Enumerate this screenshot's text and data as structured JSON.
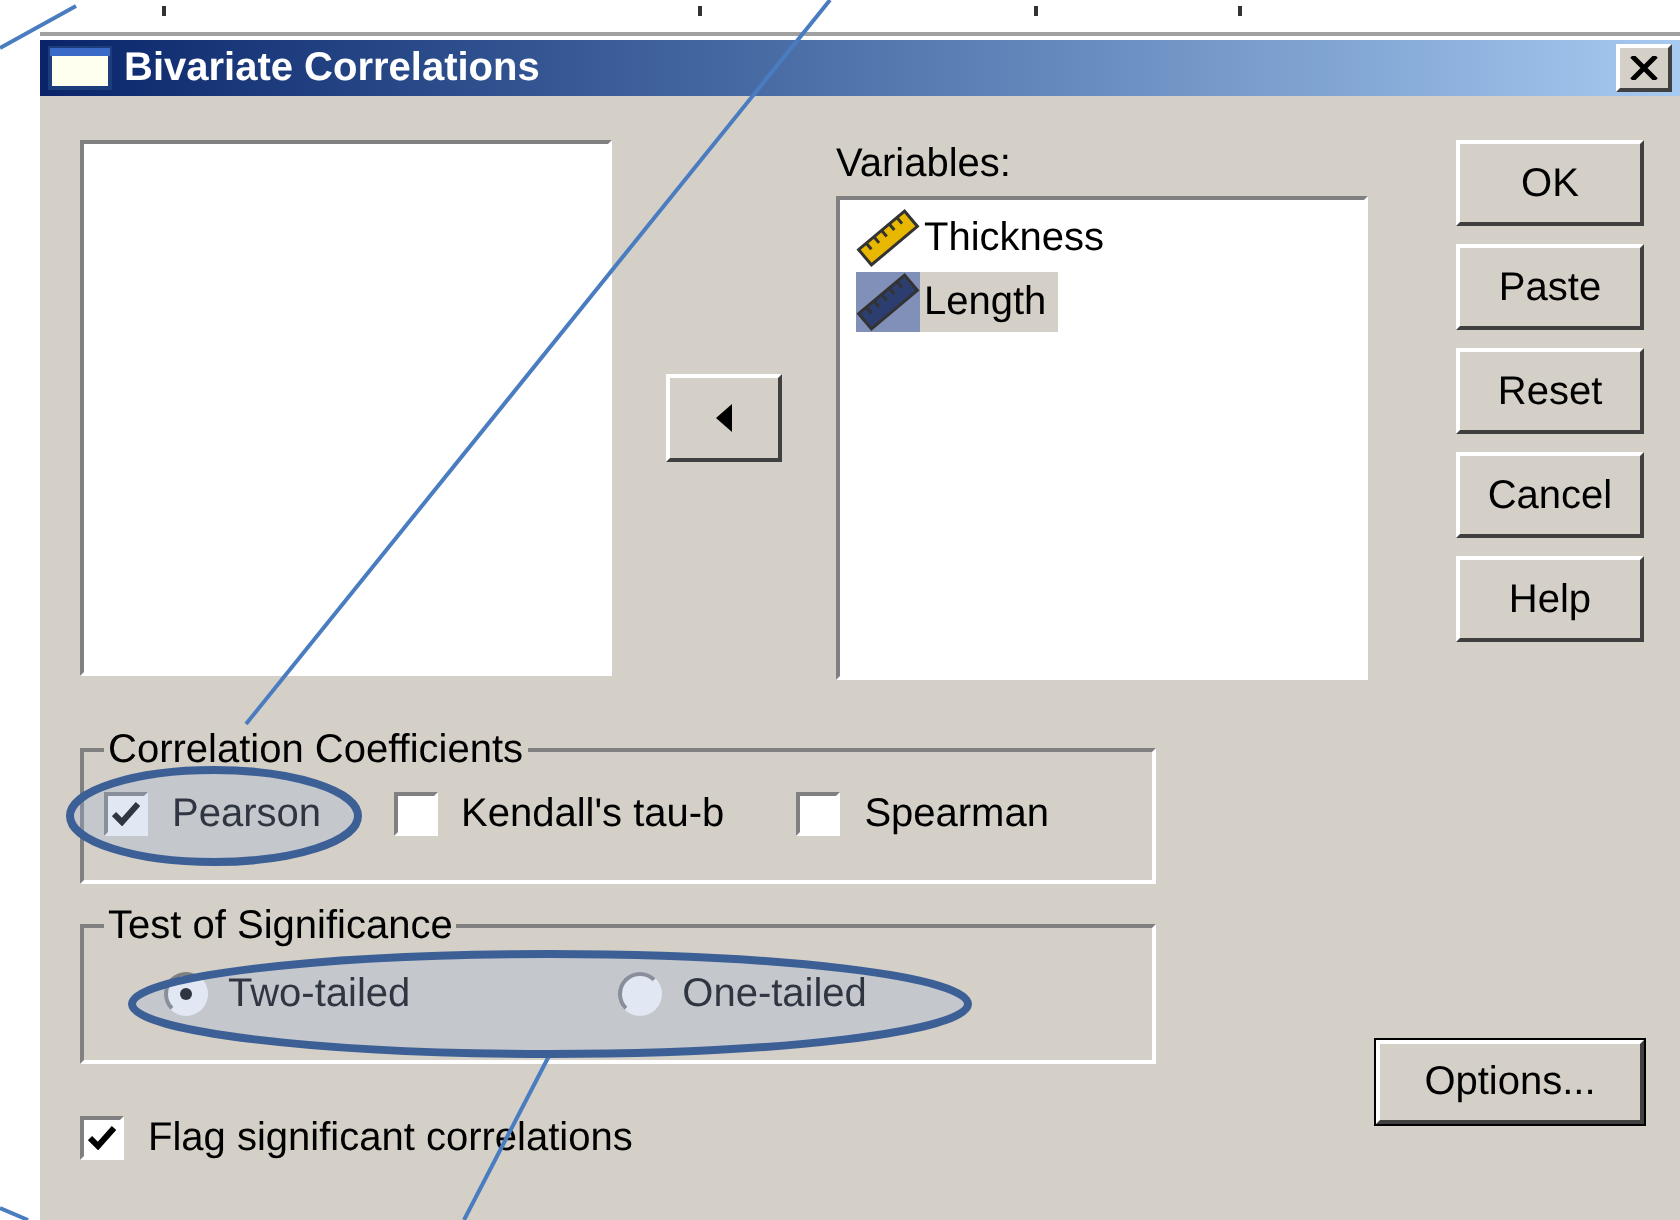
{
  "window": {
    "title": "Bivariate Correlations"
  },
  "variables": {
    "label": "Variables:",
    "items": [
      {
        "name": "Thickness",
        "selected": false
      },
      {
        "name": "Length",
        "selected": true
      }
    ]
  },
  "buttons": [
    "OK",
    "Paste",
    "Reset",
    "Cancel",
    "Help"
  ],
  "coefficients": {
    "title": "Correlation Coefficients",
    "items": [
      {
        "label": "Pearson",
        "checked": true
      },
      {
        "label": "Kendall's tau-b",
        "checked": false
      },
      {
        "label": "Spearman",
        "checked": false
      }
    ]
  },
  "significance": {
    "title": "Test of Significance",
    "items": [
      {
        "label": "Two-tailed",
        "selected": true
      },
      {
        "label": "One-tailed",
        "selected": false
      }
    ]
  },
  "flag": {
    "label": "Flag significant correlations",
    "checked": true
  },
  "options_button": "Options..."
}
